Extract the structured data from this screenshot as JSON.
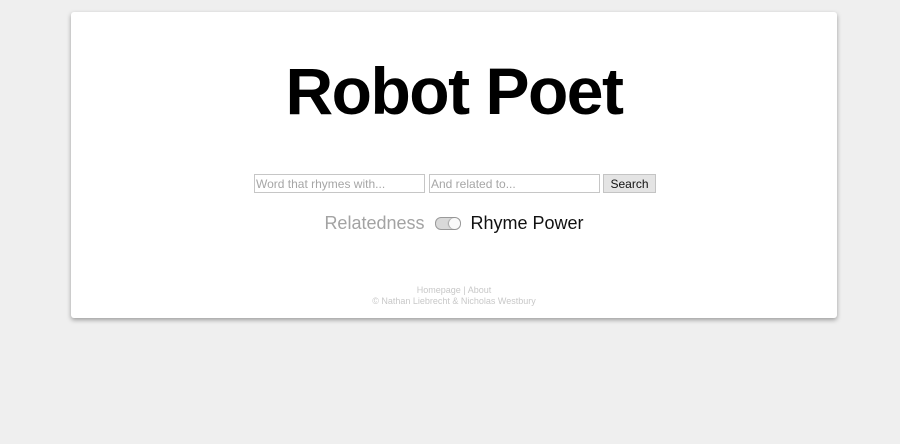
{
  "app": {
    "title": "Robot Poet"
  },
  "search": {
    "rhyme_placeholder": "Word that rhymes with...",
    "rhyme_value": "",
    "related_placeholder": "And related to...",
    "related_value": "",
    "button_label": "Search"
  },
  "toggle": {
    "left_label": "Relatedness",
    "right_label": "Rhyme Power",
    "selected": "Rhyme Power"
  },
  "footer": {
    "homepage_link": "Homepage",
    "separator": "|",
    "about_link": "About",
    "credits": "© Nathan Liebrecht & Nicholas Westbury"
  },
  "colors": {
    "background": "#efefef",
    "card": "#ffffff",
    "muted_text": "#a3a3a3",
    "footer_text": "#c8c8c8"
  }
}
